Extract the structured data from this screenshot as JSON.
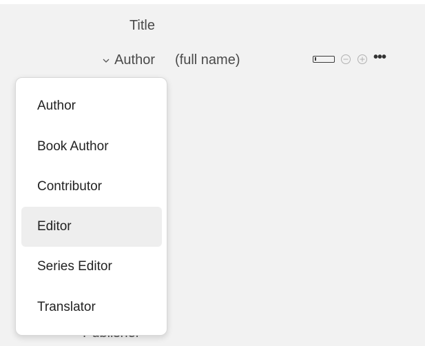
{
  "fields": {
    "title_label": "Title",
    "creator_type": "Author",
    "creator_value_placeholder": "(full name)",
    "publisher_label": "Publisher"
  },
  "creator_type_menu": {
    "items": [
      {
        "label": "Author"
      },
      {
        "label": "Book Author"
      },
      {
        "label": "Contributor"
      },
      {
        "label": "Editor",
        "highlighted": true
      },
      {
        "label": "Series Editor"
      },
      {
        "label": "Translator"
      }
    ]
  },
  "icons": {
    "chevron": "chevron-down-icon",
    "switch_mode": "field-mode-icon",
    "remove": "minus-circle-icon",
    "add": "plus-circle-icon",
    "more": "more-options-icon"
  },
  "colors": {
    "background": "#f2f2f2",
    "menu_background": "#ffffff",
    "highlight": "#eeeeee"
  }
}
